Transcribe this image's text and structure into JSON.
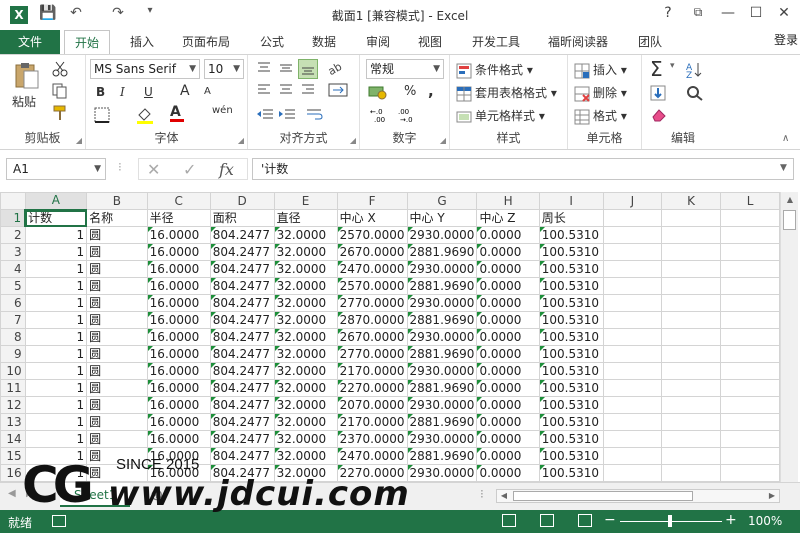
{
  "window": {
    "title": "截面1  [兼容模式] - Excel",
    "app_icon_letter": "X",
    "help": "?",
    "restore_ribbon": "⧉",
    "minimize": "—",
    "maximize": "☐",
    "close": "✕"
  },
  "quick_access": {
    "save": "💾",
    "undo": "↶",
    "redo": "↷",
    "customize": "▾"
  },
  "tabs": {
    "file": "文件",
    "items": [
      "开始",
      "插入",
      "页面布局",
      "公式",
      "数据",
      "审阅",
      "视图",
      "开发工具",
      "福昕阅读器",
      "团队"
    ],
    "active": "开始",
    "signin": "登录"
  },
  "ribbon": {
    "clipboard": {
      "label": "剪贴板",
      "paste": "粘贴"
    },
    "font": {
      "label": "字体",
      "name": "MS Sans Serif",
      "size": "10",
      "bold": "B",
      "italic": "I",
      "underline": "U",
      "phonetic": "wén",
      "font_color_glyph": "A",
      "increase": "A",
      "decrease": "A"
    },
    "alignment": {
      "label": "对齐方式"
    },
    "number": {
      "label": "数字",
      "format": "常规",
      "percent": "%",
      "comma": ",",
      "inc_dec": "⁰⁰",
      "dec_dec": "⁰⁰"
    },
    "styles": {
      "label": "样式",
      "conditional": "条件格式",
      "table": "套用表格格式",
      "cell": "单元格样式"
    },
    "cells": {
      "label": "单元格",
      "insert": "插入",
      "delete": "删除",
      "format": "格式"
    },
    "editing": {
      "label": "编辑",
      "sum": "Σ",
      "sort": "A",
      "fill": "↓",
      "find": "⌕",
      "clear": "◆"
    }
  },
  "formula_bar": {
    "name_box": "A1",
    "cancel": "✕",
    "enter": "✓",
    "fx": "fx",
    "content": "'计数"
  },
  "sheet": {
    "columns": [
      "A",
      "B",
      "C",
      "D",
      "E",
      "F",
      "G",
      "H",
      "I",
      "J",
      "K",
      "L"
    ],
    "header_row": [
      "计数",
      "名称",
      "半径",
      "面积",
      "直径",
      "中心 X",
      "中心 Y",
      "中心 Z",
      "周长"
    ],
    "rows": [
      [
        "2",
        "1",
        "圆",
        "16.0000",
        "804.2477",
        "32.0000",
        "2570.0000",
        "2930.0000",
        "0.0000",
        "100.5310"
      ],
      [
        "3",
        "1",
        "圆",
        "16.0000",
        "804.2477",
        "32.0000",
        "2670.0000",
        "2881.9690",
        "0.0000",
        "100.5310"
      ],
      [
        "4",
        "1",
        "圆",
        "16.0000",
        "804.2477",
        "32.0000",
        "2470.0000",
        "2930.0000",
        "0.0000",
        "100.5310"
      ],
      [
        "5",
        "1",
        "圆",
        "16.0000",
        "804.2477",
        "32.0000",
        "2570.0000",
        "2881.9690",
        "0.0000",
        "100.5310"
      ],
      [
        "6",
        "1",
        "圆",
        "16.0000",
        "804.2477",
        "32.0000",
        "2770.0000",
        "2930.0000",
        "0.0000",
        "100.5310"
      ],
      [
        "7",
        "1",
        "圆",
        "16.0000",
        "804.2477",
        "32.0000",
        "2870.0000",
        "2881.9690",
        "0.0000",
        "100.5310"
      ],
      [
        "8",
        "1",
        "圆",
        "16.0000",
        "804.2477",
        "32.0000",
        "2670.0000",
        "2930.0000",
        "0.0000",
        "100.5310"
      ],
      [
        "9",
        "1",
        "圆",
        "16.0000",
        "804.2477",
        "32.0000",
        "2770.0000",
        "2881.9690",
        "0.0000",
        "100.5310"
      ],
      [
        "10",
        "1",
        "圆",
        "16.0000",
        "804.2477",
        "32.0000",
        "2170.0000",
        "2930.0000",
        "0.0000",
        "100.5310"
      ],
      [
        "11",
        "1",
        "圆",
        "16.0000",
        "804.2477",
        "32.0000",
        "2270.0000",
        "2881.9690",
        "0.0000",
        "100.5310"
      ],
      [
        "12",
        "1",
        "圆",
        "16.0000",
        "804.2477",
        "32.0000",
        "2070.0000",
        "2930.0000",
        "0.0000",
        "100.5310"
      ],
      [
        "13",
        "1",
        "圆",
        "16.0000",
        "804.2477",
        "32.0000",
        "2170.0000",
        "2881.9690",
        "0.0000",
        "100.5310"
      ],
      [
        "14",
        "1",
        "圆",
        "16.0000",
        "804.2477",
        "32.0000",
        "2370.0000",
        "2930.0000",
        "0.0000",
        "100.5310"
      ],
      [
        "15",
        "1",
        "圆",
        "16.0000",
        "804.2477",
        "32.0000",
        "2470.0000",
        "2881.9690",
        "0.0000",
        "100.5310"
      ],
      [
        "16",
        "1",
        "圆",
        "16.0000",
        "804.2477",
        "32.0000",
        "2270.0000",
        "2930.0000",
        "0.0000",
        "100.5310"
      ]
    ],
    "tab_name": "Sheet1"
  },
  "status": {
    "ready": "就绪",
    "zoom": "100%",
    "zoom_minus": "−",
    "zoom_plus": "+"
  },
  "watermark": {
    "logo": "CG",
    "since": "SINCE 2015",
    "url": "www.jdcui.com"
  },
  "colors": {
    "accent": "#217346",
    "text_marker": "#1d8f3a"
  }
}
